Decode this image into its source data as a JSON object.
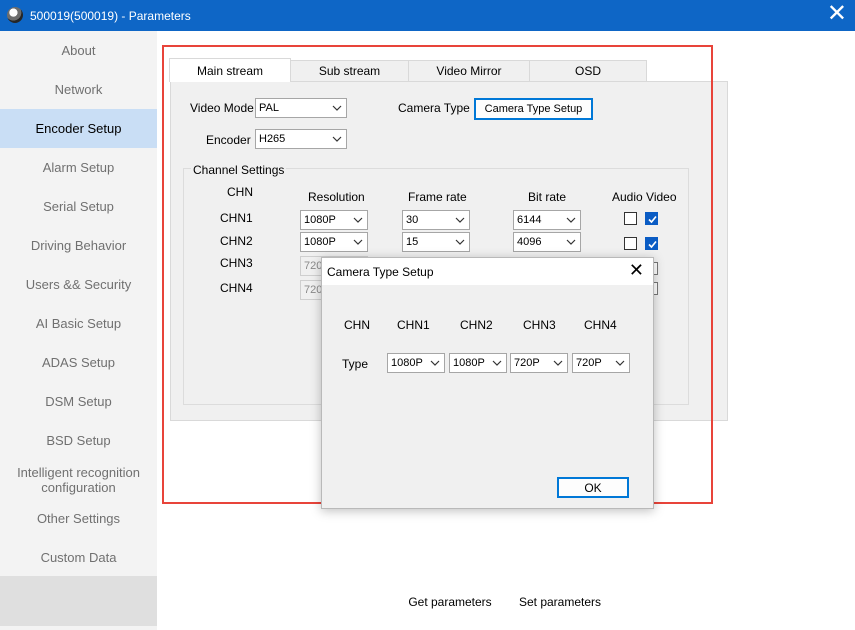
{
  "window": {
    "title": "500019(500019) - Parameters",
    "close_glyph": "✕"
  },
  "sidebar": {
    "items": [
      {
        "label": "About"
      },
      {
        "label": "Network"
      },
      {
        "label": "Encoder Setup"
      },
      {
        "label": "Alarm Setup"
      },
      {
        "label": "Serial Setup"
      },
      {
        "label": "Driving Behavior"
      },
      {
        "label": "Users && Security"
      },
      {
        "label": "AI Basic Setup"
      },
      {
        "label": "ADAS Setup"
      },
      {
        "label": "DSM Setup"
      },
      {
        "label": "BSD Setup"
      },
      {
        "label": "Intelligent recognition configuration"
      },
      {
        "label": "Other Settings"
      },
      {
        "label": "Custom Data"
      }
    ],
    "active": "Encoder Setup"
  },
  "tabs": [
    {
      "label": "Main stream"
    },
    {
      "label": "Sub stream"
    },
    {
      "label": "Video Mirror"
    },
    {
      "label": "OSD"
    }
  ],
  "main": {
    "video_mode_label": "Video Mode",
    "video_mode_value": "PAL",
    "encoder_label": "Encoder",
    "encoder_value": "H265",
    "camera_type_label": "Camera Type",
    "camera_type_button": "Camera Type Setup",
    "channel_settings_title": "Channel Settings",
    "headers": {
      "chn": "CHN",
      "resolution": "Resolution",
      "frame_rate": "Frame rate",
      "bit_rate": "Bit rate",
      "audio_video": "Audio Video"
    },
    "channels": [
      {
        "name": "CHN1",
        "resolution": "1080P",
        "frame_rate": "30",
        "bit_rate": "6144",
        "audio": false,
        "video": true
      },
      {
        "name": "CHN2",
        "resolution": "1080P",
        "frame_rate": "15",
        "bit_rate": "4096",
        "audio": false,
        "video": true
      },
      {
        "name": "CHN3",
        "resolution": "720"
      },
      {
        "name": "CHN4",
        "resolution": "720"
      }
    ]
  },
  "dialog": {
    "title": "Camera Type Setup",
    "close_glyph": "✕",
    "columns": [
      "CHN",
      "CHN1",
      "CHN2",
      "CHN3",
      "CHN4"
    ],
    "row_label": "Type",
    "values": [
      "1080P",
      "1080P",
      "720P",
      "720P"
    ],
    "ok_label": "OK"
  },
  "bottom": {
    "get_label": "Get parameters",
    "set_label": "Set parameters"
  },
  "colors": {
    "titlebar": "#0e66c6",
    "active_sidebar": "#c9def5",
    "highlight": "#e8443a",
    "checkbox_checked": "#0a5cc4"
  }
}
